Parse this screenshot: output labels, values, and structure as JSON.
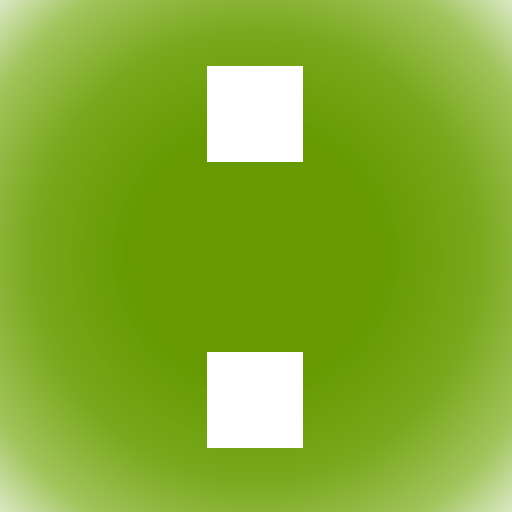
{
  "colors": {
    "center_green": "#669a00",
    "mid_green": "#78a81c",
    "outer_green": "#a2c45c",
    "edge_tint": "#d6e7be",
    "square_fill": "#ffffff"
  },
  "icon": {
    "name": "colon-icon"
  }
}
